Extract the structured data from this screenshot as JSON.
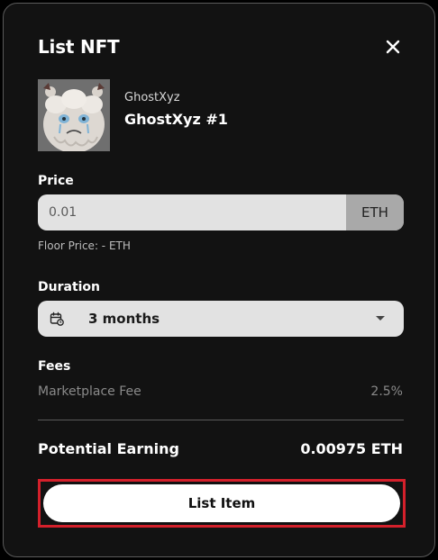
{
  "modal": {
    "title": "List NFT"
  },
  "nft": {
    "collection": "GhostXyz",
    "name": "GhostXyz #1"
  },
  "price": {
    "label": "Price",
    "value": "0.01",
    "unit": "ETH",
    "floor_text": "Floor Price: - ETH"
  },
  "duration": {
    "label": "Duration",
    "value": "3 months"
  },
  "fees": {
    "label": "Fees",
    "marketplace_label": "Marketplace Fee",
    "marketplace_value": "2.5%"
  },
  "earning": {
    "label": "Potential Earning",
    "value": "0.00975 ETH"
  },
  "action": {
    "list_label": "List Item"
  },
  "colors": {
    "background": "#121212",
    "button_highlight": "#d4202b",
    "input_bg": "#e2e2e2",
    "unit_bg": "#a9a9a9"
  },
  "icons": {
    "close": "close-icon",
    "calendar": "calendar-icon",
    "dropdown": "chevron-down-icon"
  }
}
